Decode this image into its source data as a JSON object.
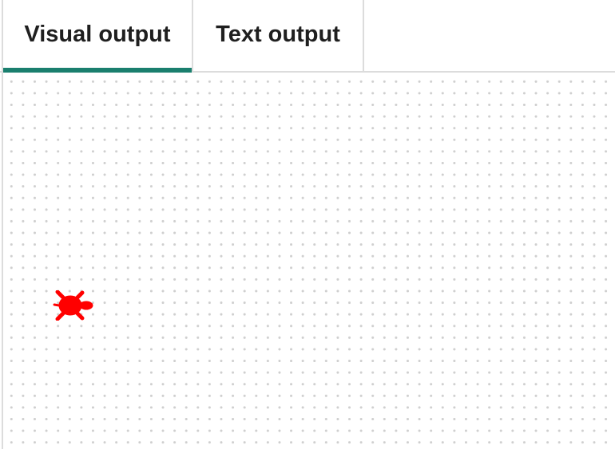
{
  "tabs": [
    {
      "label": "Visual output",
      "active": true
    },
    {
      "label": "Text output",
      "active": false
    }
  ],
  "canvas": {
    "background": "#ffffff",
    "dot_color": "#cfcfcf",
    "turtle": {
      "icon": "turtle-icon",
      "color": "#ff0000",
      "heading": "east"
    }
  },
  "colors": {
    "active_tab_indicator": "#1a7f6e",
    "tab_text": "#1f1f1f",
    "border": "#dcdcdc"
  }
}
